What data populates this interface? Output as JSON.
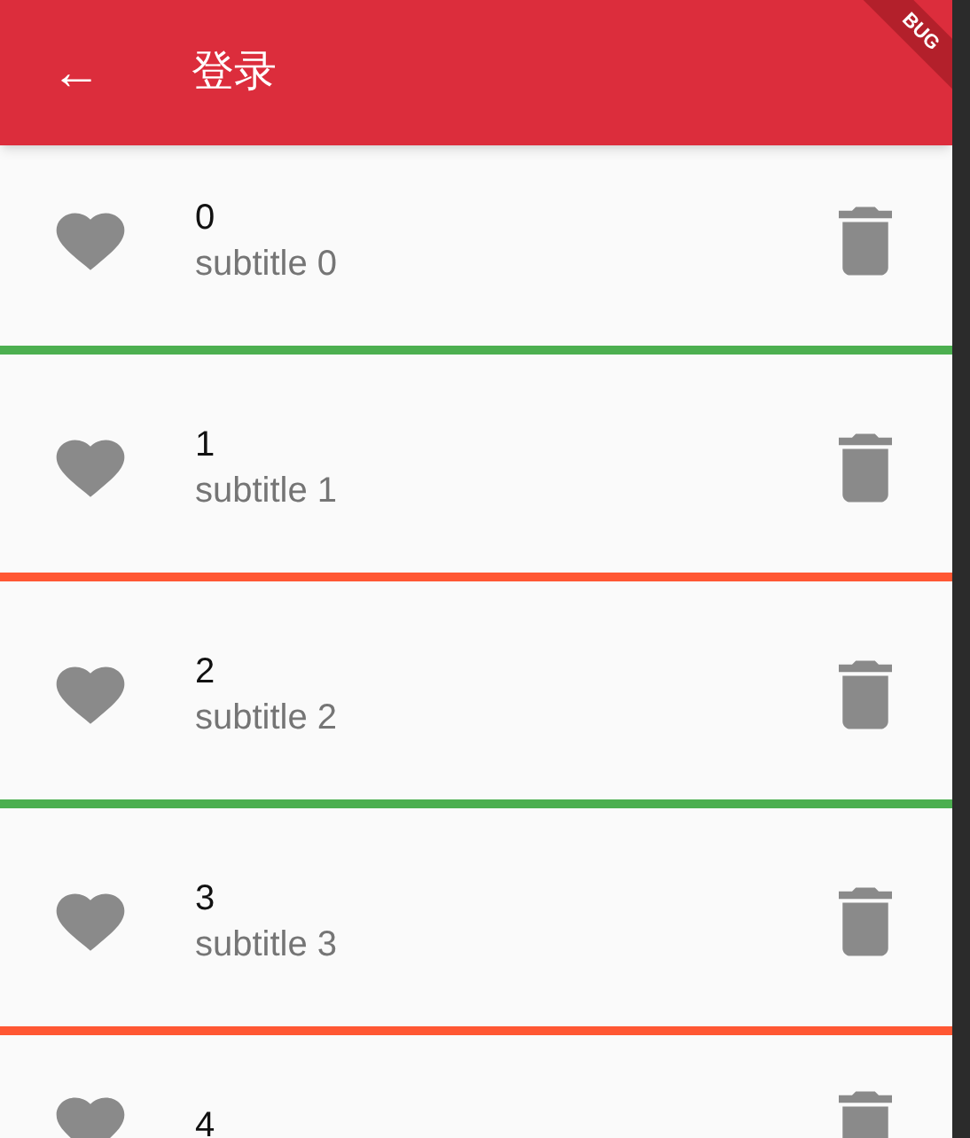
{
  "app_bar": {
    "back": "←",
    "title": "登录",
    "banner": "BUG"
  },
  "items": [
    {
      "title": "0",
      "subtitle": "subtitle 0",
      "color": "#4caf50"
    },
    {
      "title": "1",
      "subtitle": "subtitle 1",
      "color": "#ff5733"
    },
    {
      "title": "2",
      "subtitle": "subtitle 2",
      "color": "#4caf50"
    },
    {
      "title": "3",
      "subtitle": "subtitle 3",
      "color": "#ff5733"
    },
    {
      "title": "4"
    }
  ]
}
